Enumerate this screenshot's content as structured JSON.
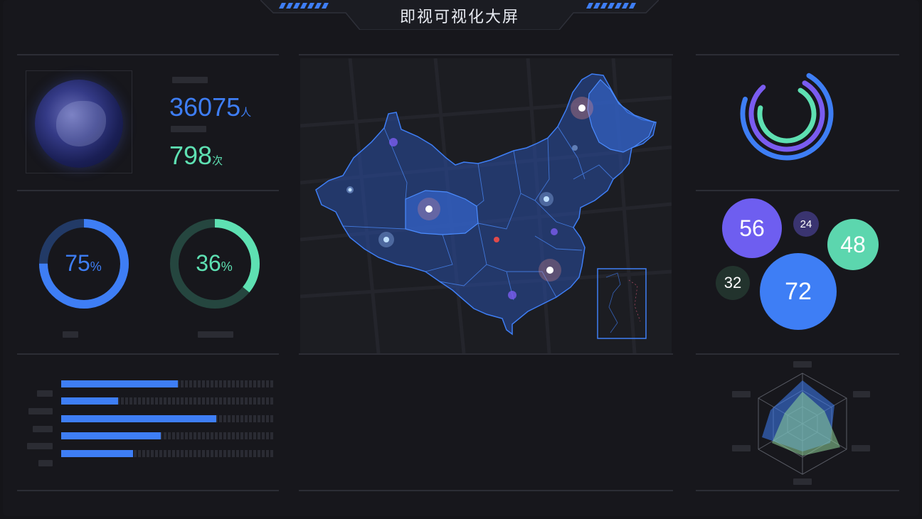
{
  "header": {
    "title": "即视可视化大屏"
  },
  "stats": {
    "people": {
      "value": "36075",
      "unit": "人"
    },
    "times": {
      "value": "798",
      "unit": "次"
    }
  },
  "rings": [
    {
      "value": "75",
      "suffix": "%",
      "fraction": 0.75,
      "color": "#3e7ef5",
      "track": "#223a66"
    },
    {
      "value": "36",
      "suffix": "%",
      "fraction": 0.36,
      "color": "#5ee0b2",
      "track": "#25463f"
    }
  ],
  "concentric_rings": [
    {
      "fraction": 0.72,
      "color": "#3e7ef5"
    },
    {
      "fraction": 0.8,
      "color": "#7a5cf0"
    },
    {
      "fraction": 0.7,
      "color": "#5ee0b2"
    }
  ],
  "bubbles": [
    {
      "label": "56",
      "color": "#6e5ef0"
    },
    {
      "label": "24",
      "color": "#3a3470"
    },
    {
      "label": "48",
      "color": "#5cd6ae"
    },
    {
      "label": "32",
      "color": "#22332d"
    },
    {
      "label": "72",
      "color": "#3e7ef5"
    }
  ],
  "bars": [
    0.55,
    0.27,
    0.73,
    0.47,
    0.34
  ],
  "colors": {
    "accent_blue": "#3e7ef5",
    "accent_green": "#5ee0b2",
    "accent_purple": "#6e5ef0",
    "background": "#151519"
  }
}
